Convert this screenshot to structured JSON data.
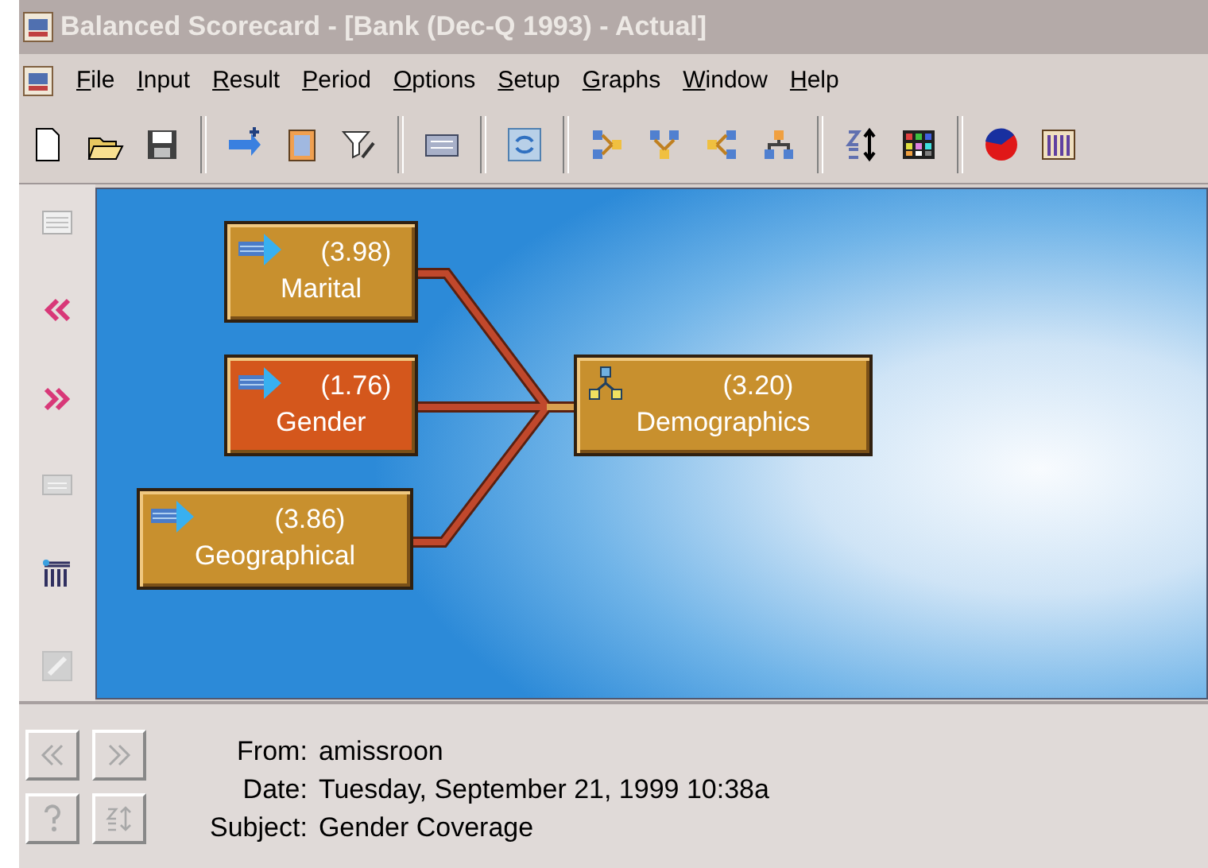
{
  "window": {
    "title": "Balanced Scorecard - [Bank (Dec-Q 1993) - Actual]",
    "active": false
  },
  "menu": [
    "File",
    "Input",
    "Result",
    "Period",
    "Options",
    "Setup",
    "Graphs",
    "Window",
    "Help"
  ],
  "diagram": {
    "nodes": [
      {
        "kind": "input",
        "value": "(3.98)",
        "label": "Marital",
        "color": "#c8902e"
      },
      {
        "kind": "input",
        "value": "(1.76)",
        "label": "Gender",
        "color": "#d4571c"
      },
      {
        "kind": "input",
        "value": "(3.86)",
        "label": "Geographical",
        "color": "#c8902e"
      },
      {
        "kind": "rollup",
        "value": "(3.20)",
        "label": "Demographics",
        "color": "#c8902e"
      }
    ]
  },
  "message": {
    "fields": [
      {
        "label": "From:",
        "value": "amissroon"
      },
      {
        "label": "Date:",
        "value": "Tuesday, September 21, 1999 10:38a"
      },
      {
        "label": "Subject:",
        "value": "Gender Coverage"
      }
    ]
  }
}
